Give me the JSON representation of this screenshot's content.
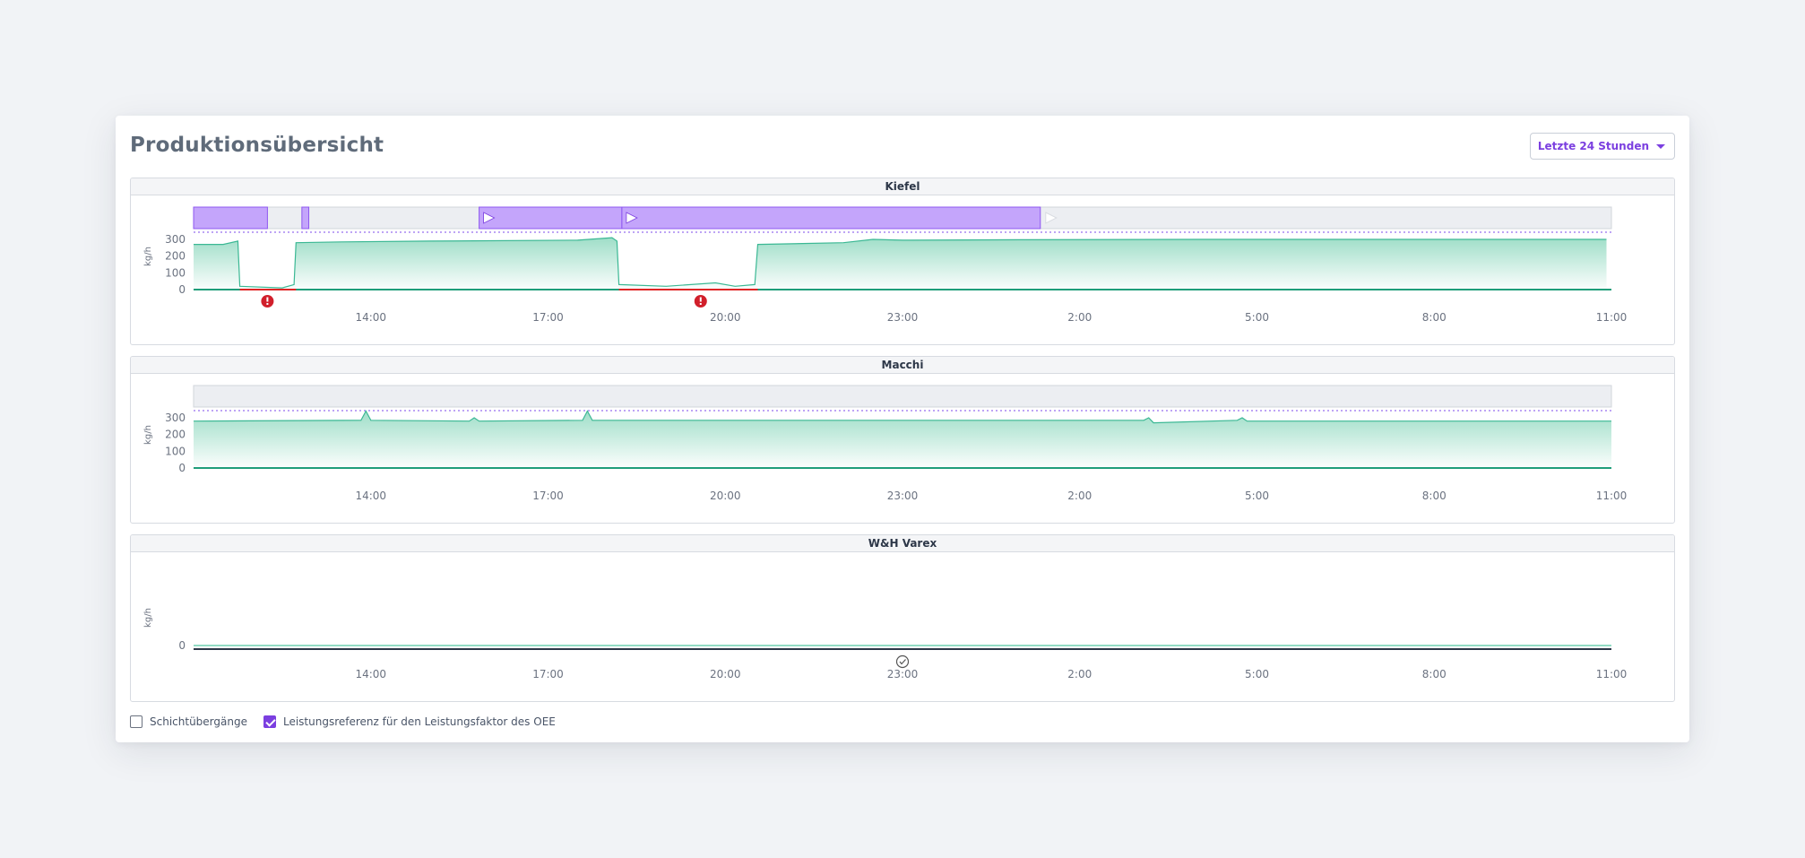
{
  "page": {
    "title": "Produktionsübersicht",
    "range_selector": "Letzte 24 Stunden"
  },
  "colors": {
    "accent": "#7b3fe0",
    "order_bar": "#c4a5fb",
    "throughput_line": "#3bb894",
    "downtime": "#e02424",
    "reference_line": "#a886f2"
  },
  "x_axis_ticks": [
    "14:00",
    "17:00",
    "20:00",
    "23:00",
    "2:00",
    "5:00",
    "8:00",
    "11:00"
  ],
  "panels": [
    {
      "name": "Kiefel",
      "unit": "kg/h",
      "y_ticks": [
        "300",
        "200",
        "100",
        "0"
      ],
      "orders": [
        {
          "start": "11:00",
          "end": "12:15",
          "icon": "none"
        },
        {
          "start": "12:50",
          "end": "12:57",
          "icon": "none"
        },
        {
          "start": "15:50",
          "end": "18:15",
          "icon": "play-icon"
        },
        {
          "start": "18:15",
          "end": "01:20",
          "icon": "play-icon"
        }
      ],
      "throughput_points": [
        {
          "t": "11:00",
          "v": 270
        },
        {
          "t": "11:30",
          "v": 270
        },
        {
          "t": "11:45",
          "v": 290
        },
        {
          "t": "11:47",
          "v": 20
        },
        {
          "t": "12:30",
          "v": 10
        },
        {
          "t": "12:42",
          "v": 30
        },
        {
          "t": "12:44",
          "v": 280
        },
        {
          "t": "13:30",
          "v": 285
        },
        {
          "t": "15:00",
          "v": 290
        },
        {
          "t": "17:30",
          "v": 295
        },
        {
          "t": "18:05",
          "v": 310
        },
        {
          "t": "18:10",
          "v": 290
        },
        {
          "t": "18:12",
          "v": 30
        },
        {
          "t": "19:00",
          "v": 20
        },
        {
          "t": "19:50",
          "v": 40
        },
        {
          "t": "20:10",
          "v": 20
        },
        {
          "t": "20:30",
          "v": 30
        },
        {
          "t": "20:33",
          "v": 270
        },
        {
          "t": "22:00",
          "v": 280
        },
        {
          "t": "22:30",
          "v": 300
        },
        {
          "t": "23:00",
          "v": 295
        },
        {
          "t": "01:00",
          "v": 298
        },
        {
          "t": "04:00",
          "v": 300
        },
        {
          "t": "08:00",
          "v": 300
        },
        {
          "t": "10:55",
          "v": 300
        }
      ],
      "downtimes": [
        {
          "start": "11:47",
          "end": "12:44"
        },
        {
          "start": "18:12",
          "end": "20:33"
        }
      ],
      "alerts": [
        {
          "t": "12:15",
          "icon": "alert-icon"
        },
        {
          "t": "19:35",
          "icon": "alert-icon"
        }
      ]
    },
    {
      "name": "Macchi",
      "unit": "kg/h",
      "y_ticks": [
        "300",
        "200",
        "100",
        "0"
      ],
      "orders": [],
      "throughput_points": [
        {
          "t": "11:00",
          "v": 280
        },
        {
          "t": "13:50",
          "v": 285
        },
        {
          "t": "13:55",
          "v": 340
        },
        {
          "t": "14:00",
          "v": 285
        },
        {
          "t": "15:40",
          "v": 280
        },
        {
          "t": "15:45",
          "v": 300
        },
        {
          "t": "15:50",
          "v": 280
        },
        {
          "t": "17:35",
          "v": 285
        },
        {
          "t": "17:40",
          "v": 340
        },
        {
          "t": "17:45",
          "v": 285
        },
        {
          "t": "03:05",
          "v": 285
        },
        {
          "t": "03:10",
          "v": 300
        },
        {
          "t": "03:15",
          "v": 270
        },
        {
          "t": "04:40",
          "v": 285
        },
        {
          "t": "04:45",
          "v": 300
        },
        {
          "t": "04:50",
          "v": 280
        },
        {
          "t": "11:00",
          "v": 280
        }
      ],
      "downtimes": [],
      "alerts": []
    },
    {
      "name": "W&H Varex",
      "unit": "kg/h",
      "y_ticks": [
        "0"
      ],
      "orders": [],
      "throughput_points": [],
      "downtimes": [],
      "alerts": [
        {
          "t": "23:00",
          "icon": "check-circle-icon"
        }
      ]
    }
  ],
  "legend": {
    "shift_transitions": {
      "label": "Schichtübergänge",
      "checked": false
    },
    "performance_reference": {
      "label": "Leistungsreferenz für den Leistungsfaktor des OEE",
      "checked": true
    }
  }
}
